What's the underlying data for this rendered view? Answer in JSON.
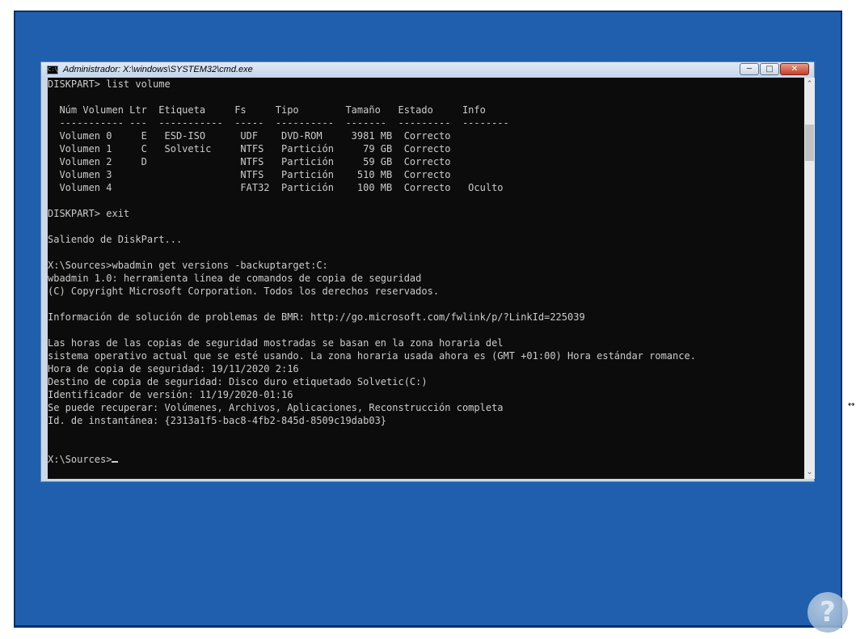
{
  "window": {
    "title": "Administrador: X:\\windows\\SYSTEM32\\cmd.exe",
    "app_icon": "C:\\",
    "minimize_icon": "cmd-minimize-icon",
    "maximize_icon": "cmd-maximize-icon",
    "close_icon": "cmd-close-icon"
  },
  "console": {
    "lines": [
      "DISKPART> list volume",
      "",
      "  Núm Volumen Ltr  Etiqueta     Fs     Tipo        Tamaño   Estado     Info",
      "  ----------- ---  -----------  -----  ----------  -------  ---------  --------",
      "  Volumen 0     E   ESD-ISO      UDF    DVD-ROM     3981 MB  Correcto",
      "  Volumen 1     C   Solvetic     NTFS   Partición     79 GB  Correcto",
      "  Volumen 2     D                NTFS   Partición     59 GB  Correcto",
      "  Volumen 3                      NTFS   Partición    510 MB  Correcto",
      "  Volumen 4                      FAT32  Partición    100 MB  Correcto   Oculto",
      "",
      "DISKPART> exit",
      "",
      "Saliendo de DiskPart...",
      "",
      "X:\\Sources>wbadmin get versions -backuptarget:C:",
      "wbadmin 1.0: herramienta línea de comandos de copia de seguridad",
      "(C) Copyright Microsoft Corporation. Todos los derechos reservados.",
      "",
      "Información de solución de problemas de BMR: http://go.microsoft.com/fwlink/p/?LinkId=225039",
      "",
      "Las horas de las copias de seguridad mostradas se basan en la zona horaria del",
      "sistema operativo actual que se esté usando. La zona horaria usada ahora es (GMT +01:00) Hora estándar romance.",
      "Hora de copia de seguridad: 19/11/2020 2:16",
      "Destino de copia de seguridad: Disco duro etiquetado Solvetic(C:)",
      "Identificador de versión: 11/19/2020-01:16",
      "Se puede recuperar: Volúmenes, Archivos, Aplicaciones, Reconstrucción completa",
      "Id. de instantánea: {2313a1f5-bac8-4fb2-845d-8509c19dab03}",
      "",
      ""
    ],
    "prompt": "X:\\Sources>"
  },
  "scrollbar": {
    "up_icon": "scroll-up-icon",
    "down_icon": "scroll-down-icon",
    "position_percent": 10
  },
  "colors": {
    "desktop": "#1f5fae",
    "console_bg": "#0c0c0c",
    "console_fg": "#cccccc"
  }
}
